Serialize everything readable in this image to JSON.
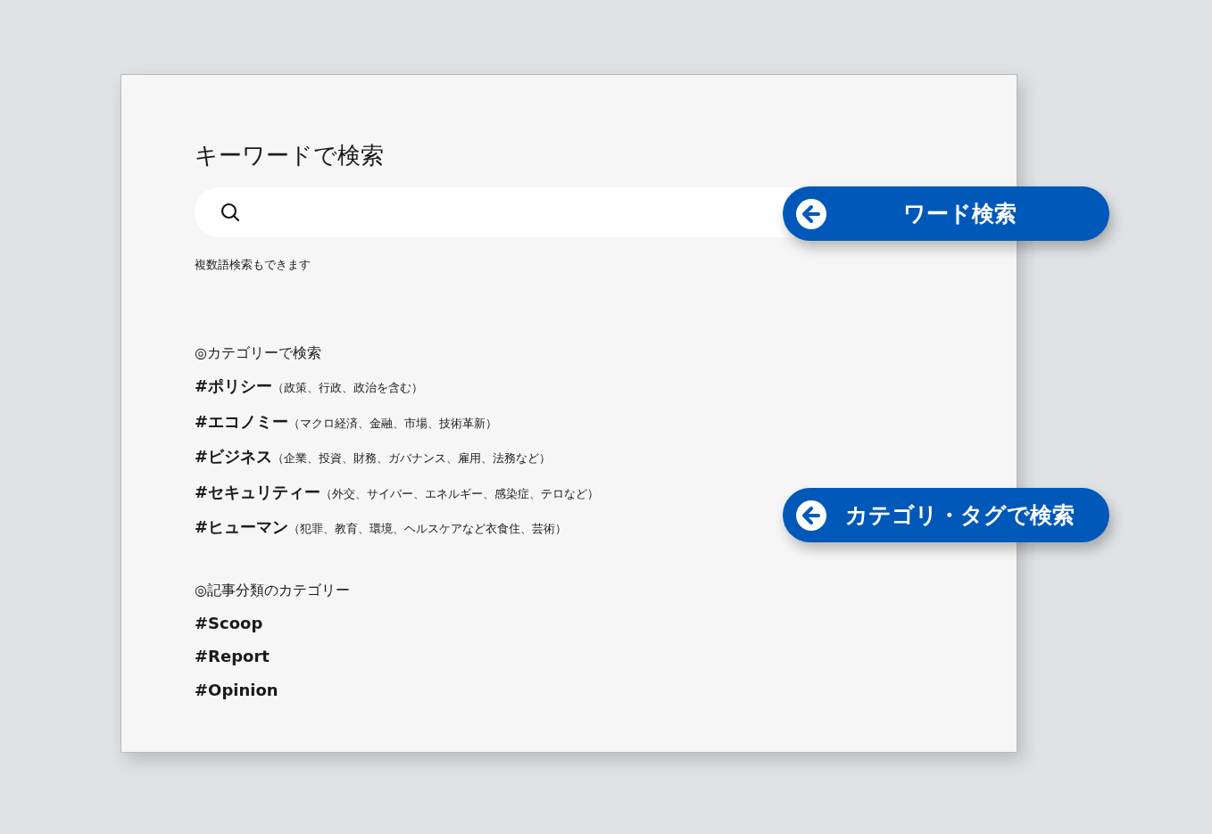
{
  "title": "キーワードで検索",
  "search": {
    "helper_text": "複数語検索もできます"
  },
  "sections": [
    {
      "heading": "◎カテゴリーで検索",
      "tags": [
        {
          "name": "#ポリシー",
          "note": "（政策、行政、政治を含む）"
        },
        {
          "name": "#エコノミー",
          "note": "（マクロ経済、金融、市場、技術革新）"
        },
        {
          "name": "#ビジネス",
          "note": "（企業、投資、財務、ガバナンス、雇用、法務など）"
        },
        {
          "name": "#セキュリティー",
          "note": "（外交、サイバー、エネルギー、感染症、テロなど）"
        },
        {
          "name": "#ヒューマン",
          "note": "（犯罪、教育、環境、ヘルスケアなど衣食住、芸術）"
        }
      ]
    },
    {
      "heading": "◎記事分類のカテゴリー",
      "tags": [
        {
          "name": "#Scoop"
        },
        {
          "name": "#Report"
        },
        {
          "name": "#Opinion"
        }
      ]
    }
  ],
  "callouts": [
    {
      "label": "ワード検索"
    },
    {
      "label": "カテゴリ・タグで検索"
    }
  ]
}
